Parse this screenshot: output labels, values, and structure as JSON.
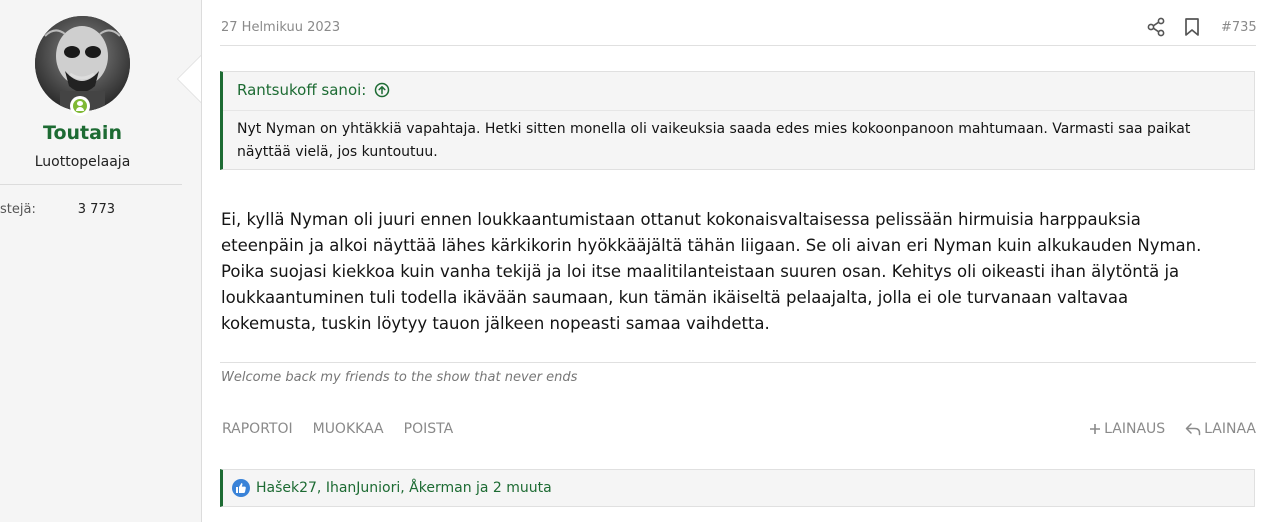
{
  "user": {
    "name": "Toutain",
    "title": "Luottopelaaja",
    "stat_label": "estejä:",
    "stat_value": "3 773"
  },
  "post": {
    "date": "27 Helmikuu 2023",
    "number": "#735",
    "quote": {
      "author": "Rantsukoff sanoi:",
      "text": "Nyt Nyman on yhtäkkiä vapahtaja. Hetki sitten monella oli vaikeuksia saada edes mies kokoonpanoon mahtumaan. Varmasti saa paikat näyttää vielä, jos kuntoutuu."
    },
    "message_lines": [
      "Ei, kyllä Nyman oli juuri ennen loukkaantumistaan ottanut kokonaisvaltaisessa pelissään hirmuisia harppauksia",
      "eteenpäin ja alkoi näyttää lähes kärkikorin hyökkääjältä tähän liigaan. Se oli aivan eri Nyman kuin alkukauden Nyman.",
      "Poika suojasi kiekkoa kuin vanha tekijä ja loi itse maalitilanteistaan suuren osan. Kehitys oli oikeasti ihan älytöntä ja",
      "loukkaantuminen tuli todella ikävään saumaan, kun tämän ikäiseltä pelaajalta, jolla ei ole turvanaan valtavaa",
      "kokemusta, tuskin löytyy tauon jälkeen nopeasti samaa vaihdetta."
    ],
    "signature": "Welcome back my friends to the show that never ends",
    "actions_left": [
      "RAPORTOI",
      "MUOKKAA",
      "POISTA"
    ],
    "action_quote_plus": "LAINAUS",
    "action_reply": "LAINAA",
    "reactions": "Hašek27, IhanJuniori, Åkerman ja 2 muuta"
  },
  "colors": {
    "accent": "#1d6b33",
    "like": "#3a83d8",
    "online": "#7fb935"
  }
}
